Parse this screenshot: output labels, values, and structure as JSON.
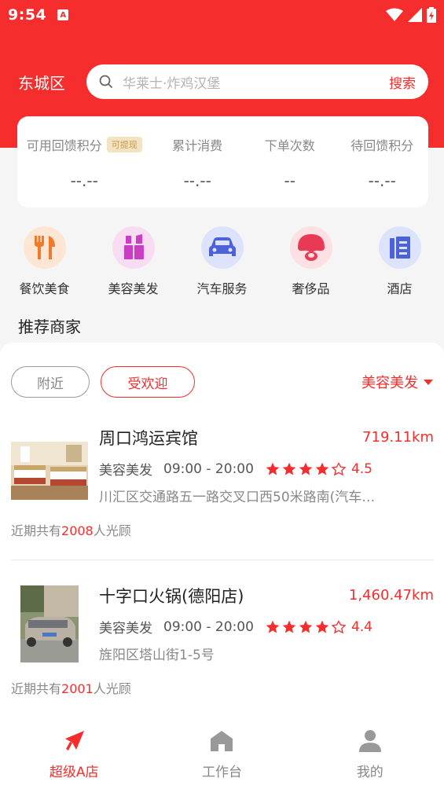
{
  "status_bar": {
    "time": "9:54",
    "notif_badge": "A"
  },
  "header": {
    "district": "东城区",
    "search": {
      "placeholder": "华莱士·炸鸡汉堡",
      "button_label": "搜索"
    }
  },
  "stats": [
    {
      "label": "可用回馈积分",
      "badge": "可提现",
      "value": "--.--"
    },
    {
      "label": "累计消费",
      "value": "--.--"
    },
    {
      "label": "下单次数",
      "value": "--"
    },
    {
      "label": "待回馈积分",
      "value": "--.--"
    }
  ],
  "categories": [
    {
      "label": "餐饮美食",
      "icon": "utensils-icon"
    },
    {
      "label": "美容美发",
      "icon": "lipstick-icon"
    },
    {
      "label": "汽车服务",
      "icon": "car-icon"
    },
    {
      "label": "奢侈品",
      "icon": "mushroom-icon"
    },
    {
      "label": "酒店",
      "icon": "hotel-icon"
    }
  ],
  "section_title": "推荐商家",
  "filters": {
    "nearby": "附近",
    "popular": "受欢迎",
    "category": "美容美发"
  },
  "merchants": [
    {
      "name": "周口鸿运宾馆",
      "distance": "719.11km",
      "category": "美容美发",
      "hours": "09:00 - 20:00",
      "rating": "4.5",
      "stars_filled": 4,
      "address": "川汇区交通路五一路交叉口西50米路南(汽车…",
      "visits_prefix": "近期共有",
      "visits": "2008",
      "visits_suffix": "人光顾"
    },
    {
      "name": "十字口火锅(德阳店)",
      "distance": "1,460.47km",
      "category": "美容美发",
      "hours": "09:00 - 20:00",
      "rating": "4.4",
      "stars_filled": 4,
      "address": "旌阳区塔山街1-5号",
      "visits_prefix": "近期共有",
      "visits": "2001",
      "visits_suffix": "人光顾"
    }
  ],
  "tabs": [
    {
      "label": "超级A店",
      "icon": "rocket-icon",
      "active": true
    },
    {
      "label": "工作台",
      "icon": "home-icon",
      "active": false
    },
    {
      "label": "我的",
      "icon": "user-icon",
      "active": false
    }
  ],
  "colors": {
    "accent": "#f62d2d",
    "badge_bg": "#f3e3c3",
    "badge_text": "#c99a4c"
  }
}
